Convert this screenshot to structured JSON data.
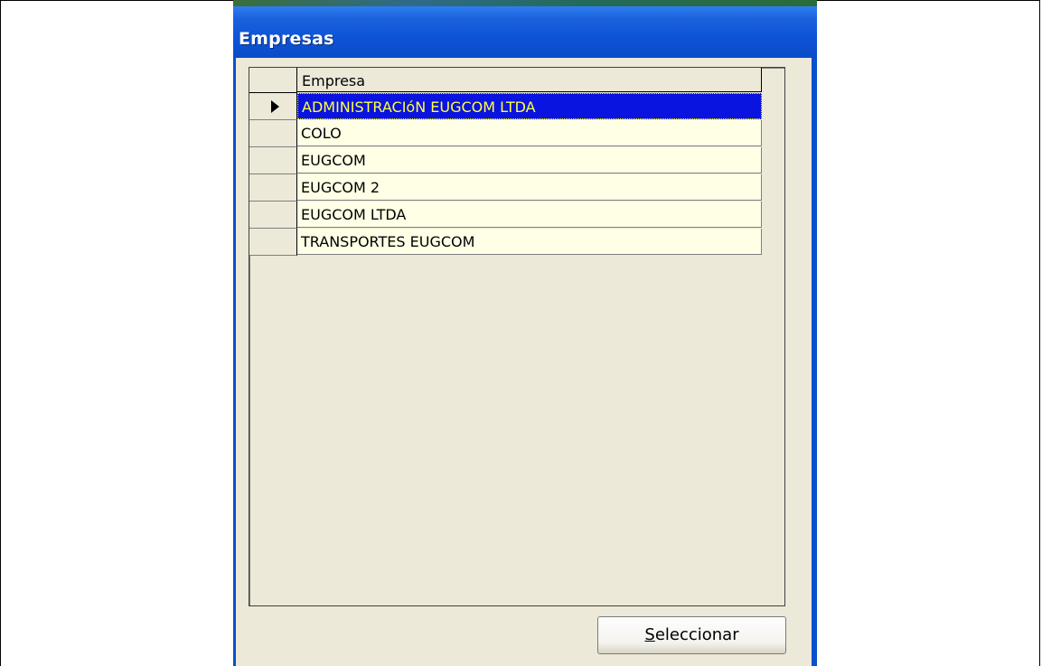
{
  "window": {
    "title": "Empresas"
  },
  "grid": {
    "column_header": "Empresa",
    "rows": [
      {
        "label": "ADMINISTRACIóN EUGCOM LTDA",
        "selected": true
      },
      {
        "label": "COLO",
        "selected": false
      },
      {
        "label": "EUGCOM",
        "selected": false
      },
      {
        "label": "EUGCOM 2",
        "selected": false
      },
      {
        "label": "EUGCOM LTDA",
        "selected": false
      },
      {
        "label": "TRANSPORTES EUGCOM",
        "selected": false
      }
    ]
  },
  "button": {
    "mnemonic": "S",
    "rest": "eleccionar"
  },
  "colors": {
    "title_bar": "#0a4fcf",
    "selection": "#0a14e0",
    "selection_text": "#ffff40",
    "row_bg": "#ffffe6"
  }
}
